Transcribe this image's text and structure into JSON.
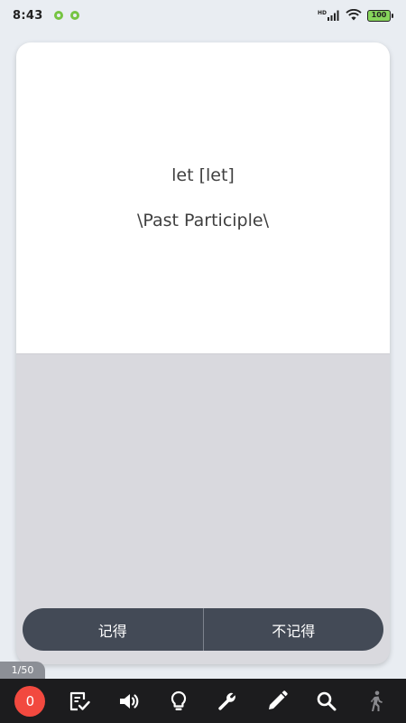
{
  "status_bar": {
    "time": "8:43",
    "battery_level": "100",
    "network_label": "HD"
  },
  "card": {
    "word_line": "let [let]",
    "part_of_speech": "\\Past Participle\\"
  },
  "answers": {
    "remember_label": "记得",
    "forget_label": "不记得"
  },
  "progress": {
    "counter": "1/50"
  },
  "toolbar": {
    "count": "0",
    "icons": [
      "task-check-icon",
      "speaker-icon",
      "lightbulb-icon",
      "wrench-icon",
      "pencil-icon",
      "search-icon",
      "walking-person-icon"
    ]
  },
  "colors": {
    "background": "#e9edf2",
    "answer_bar": "#434a56",
    "toolbar": "#1c1c1e",
    "badge": "#f2493f"
  }
}
